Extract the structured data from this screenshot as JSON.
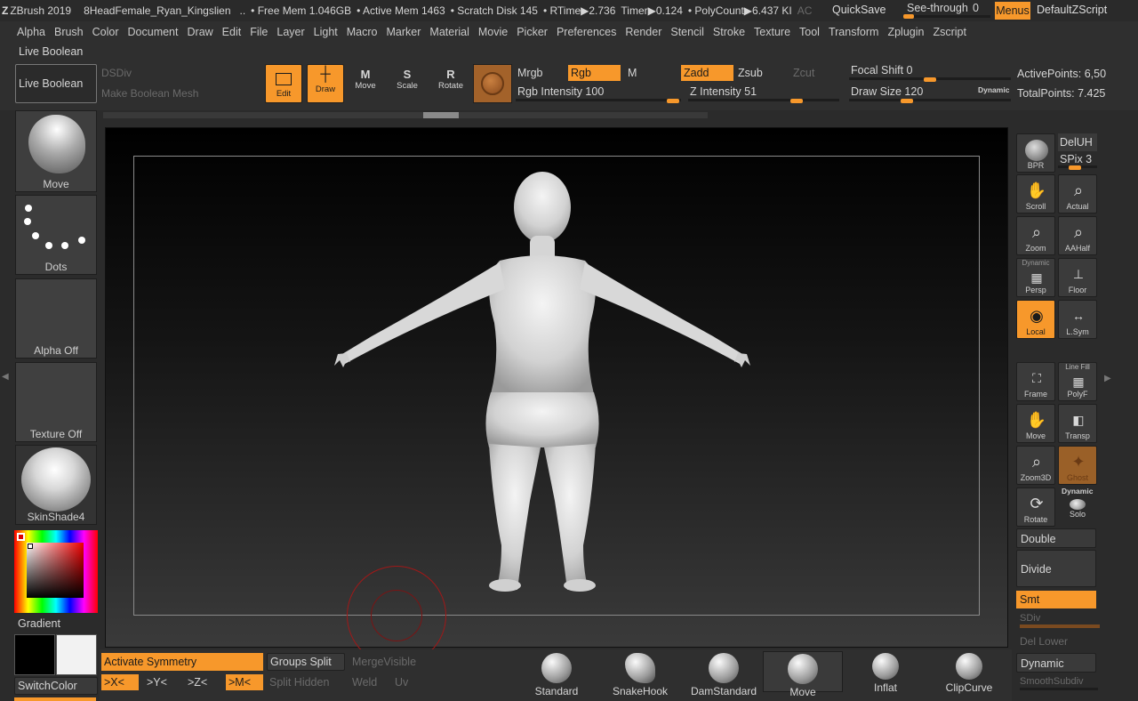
{
  "titlebar": {
    "app": "ZBrush 2019",
    "project": "8HeadFemale_Ryan_Kingslien",
    "ellipsis": "..",
    "free_mem": "• Free Mem 1.046GB",
    "active_mem": "• Active Mem 1463",
    "scratch": "• Scratch Disk 145",
    "rtime": "• RTime▶2.736",
    "timer": "Timer▶0.124",
    "polycount": "• PolyCount▶6.437 KI",
    "ac": "AC",
    "quicksave": "QuickSave",
    "seethrough": "See-through",
    "seethrough_value": "0",
    "menus": "Menus",
    "defaultzscript": "DefaultZScript"
  },
  "menubar": [
    "Alpha",
    "Brush",
    "Color",
    "Document",
    "Draw",
    "Edit",
    "File",
    "Layer",
    "Light",
    "Macro",
    "Marker",
    "Material",
    "Movie",
    "Picker",
    "Preferences",
    "Render",
    "Stencil",
    "Stroke",
    "Texture",
    "Tool",
    "Transform",
    "Zplugin",
    "Zscript"
  ],
  "toolshelf": {
    "live_boolean_title": "Live Boolean",
    "live_boolean_button": "Live Boolean",
    "dsdiv": "DSDiv",
    "make_boolean_mesh": "Make Boolean Mesh",
    "edit": "Edit",
    "draw": "Draw",
    "move": "Move",
    "scale": "Scale",
    "rotate": "Rotate",
    "mrgb": "Mrgb",
    "rgb": "Rgb",
    "m": "M",
    "zadd": "Zadd",
    "zsub": "Zsub",
    "zcut": "Zcut",
    "rgb_intensity": "Rgb Intensity 100",
    "z_intensity": "Z Intensity 51",
    "focal_shift": "Focal Shift 0",
    "draw_size": "Draw Size 120",
    "dynamic": "Dynamic",
    "active_points": "ActivePoints: 6,50",
    "total_points": "TotalPoints: 7.425"
  },
  "leftshelf": {
    "brush": "Move",
    "stroke": "Dots",
    "alpha": "Alpha Off",
    "texture": "Texture Off",
    "material": "SkinShade4",
    "gradient": "Gradient",
    "switchcolor": "SwitchColor"
  },
  "rightshelf": {
    "bpr": "BPR",
    "deluh": "DelUH",
    "spix": "SPix 3",
    "scroll": "Scroll",
    "actual": "Actual",
    "zoom": "Zoom",
    "aahalf": "AAHalf",
    "dynamic_label": "Dynamic",
    "persp": "Persp",
    "floor": "Floor",
    "local": "Local",
    "lsym": "L.Sym",
    "frame": "Frame",
    "line_fill": "Line Fill",
    "polyf": "PolyF",
    "move": "Move",
    "transp": "Transp",
    "zoom3d": "Zoom3D",
    "ghost": "Ghost",
    "rotate": "Rotate",
    "dynamic_solo": "Dynamic",
    "solo": "Solo",
    "double": "Double",
    "divide": "Divide",
    "smt": "Smt",
    "sdiv": "SDiv",
    "del_lower": "Del Lower",
    "dynamic_sub": "Dynamic",
    "smoothsubdiv": "SmoothSubdiv"
  },
  "bottomshelf": {
    "activate_symmetry": "Activate Symmetry",
    "x": ">X<",
    "y": ">Y<",
    "z": ">Z<",
    "m": ">M<",
    "groups_split": "Groups Split",
    "split_hidden": "Split Hidden",
    "merge_visible": "MergeVisible",
    "weld": "Weld",
    "uv": "Uv",
    "brushes": [
      "Standard",
      "SnakeHook",
      "DamStandard",
      "Move",
      "Inflat",
      "ClipCurve"
    ]
  },
  "colors": {
    "accent": "#f7982b",
    "bg": "#2b2b2b"
  }
}
